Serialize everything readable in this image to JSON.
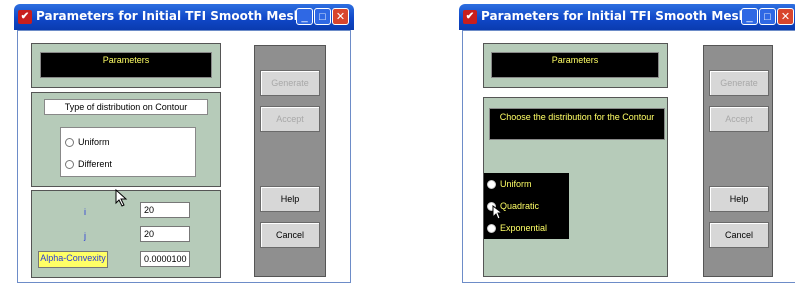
{
  "left_window": {
    "title": "Parameters for Initial TFI Smooth Mesh",
    "parameters_label": "Parameters",
    "distribution_label": "Type of distribution on Contour",
    "radio_options": [
      "Uniform",
      "Different"
    ],
    "fields": [
      {
        "label": "i",
        "value": "20"
      },
      {
        "label": "j",
        "value": "20"
      },
      {
        "label": "Alpha-Convexity",
        "value": "0.0000100"
      }
    ],
    "buttons": {
      "generate": "Generate",
      "accept": "Accept",
      "help": "Help",
      "cancel": "Cancel"
    }
  },
  "right_window": {
    "title": "Parameters for Initial TFI Smooth Mesh",
    "parameters_label": "Parameters",
    "choose_label": "Choose the distribution for the Contour",
    "radio_options": [
      "Uniform",
      "Quadratic",
      "Exponential"
    ],
    "buttons": {
      "generate": "Generate",
      "accept": "Accept",
      "help": "Help",
      "cancel": "Cancel"
    }
  },
  "colors": {
    "panel": "#b6cbb9",
    "label_yellow": "#ffff66",
    "alpha_label_bg": "#ffff66",
    "ij_label": "#2b3bd8",
    "titlebar": "#1048c8",
    "close_button": "#d8452d"
  }
}
